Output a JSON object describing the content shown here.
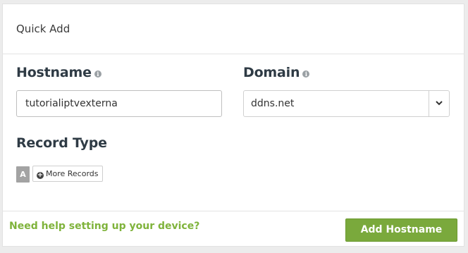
{
  "panel": {
    "title": "Quick Add"
  },
  "hostname": {
    "label": "Hostname",
    "value": "tutorialiptvexterna",
    "info_icon": "info-icon"
  },
  "domain": {
    "label": "Domain",
    "selected": "ddns.net",
    "info_icon": "info-icon",
    "toggle_icon": "chevron-down-icon"
  },
  "record_type": {
    "label": "Record Type",
    "selected": "A",
    "more_label": "More Records",
    "more_icon": "plus-circle-icon"
  },
  "footer": {
    "help_link": "Need help setting up your device?",
    "add_button": "Add Hostname"
  },
  "colors": {
    "accent": "#7aa93c",
    "link": "#7fb33b",
    "label": "#2f3b45"
  }
}
